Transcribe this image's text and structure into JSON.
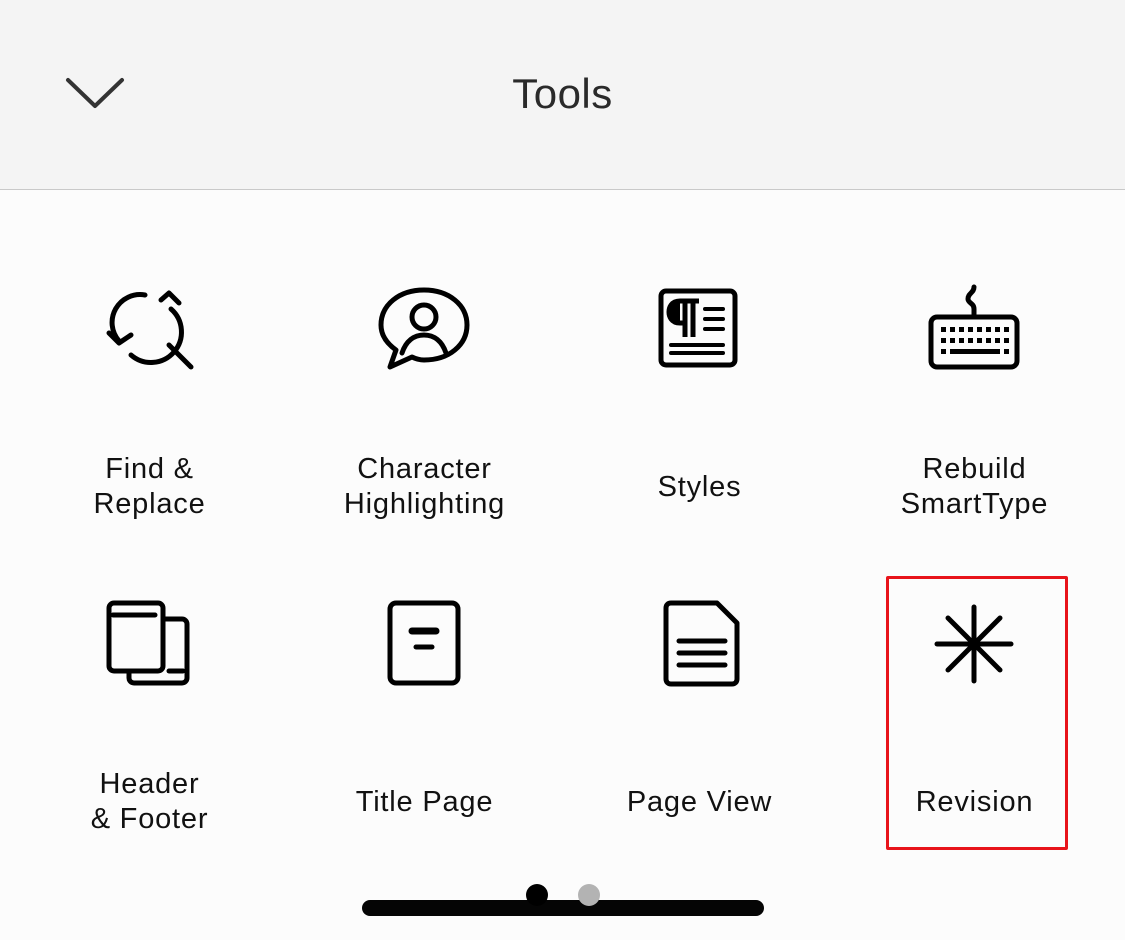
{
  "header": {
    "title": "Tools",
    "collapse_icon": "chevron-down-icon"
  },
  "tools": [
    {
      "label": "Find &\nReplace",
      "icon": "find-replace-icon"
    },
    {
      "label": "Character\nHighlighting",
      "icon": "character-highlighting-icon"
    },
    {
      "label": "Styles",
      "icon": "styles-icon"
    },
    {
      "label": "Rebuild\nSmartType",
      "icon": "keyboard-icon"
    },
    {
      "label": "Header\n& Footer",
      "icon": "header-footer-icon"
    },
    {
      "label": "Title Page",
      "icon": "title-page-icon"
    },
    {
      "label": "Page View",
      "icon": "page-view-icon"
    },
    {
      "label": "Revision",
      "icon": "asterisk-icon",
      "selected": true
    }
  ],
  "pager": {
    "page_count": 2,
    "current_page": 1,
    "active_color": "#000000",
    "inactive_color": "#b3b3b3"
  },
  "colors": {
    "highlight": "#e8141b",
    "header_bg": "#f4f4f4"
  }
}
